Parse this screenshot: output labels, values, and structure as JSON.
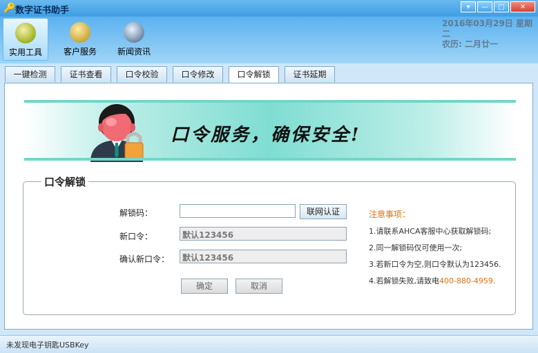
{
  "window": {
    "title": "数字证书助手"
  },
  "toolbar": {
    "items": [
      {
        "label": "实用工具",
        "icon": "tools-icon",
        "active": true
      },
      {
        "label": "客户服务",
        "icon": "customer-service-icon",
        "active": false
      },
      {
        "label": "新闻资讯",
        "icon": "news-icon",
        "active": false
      }
    ]
  },
  "date": {
    "gregorian": "2016年03月29日  星期二",
    "lunar": "农历:  二月廿一"
  },
  "tabs": [
    "一键检测",
    "证书查看",
    "口令校验",
    "口令修改",
    "口令解锁",
    "证书延期"
  ],
  "active_tab": 4,
  "banner": {
    "slogan": "口令服务，确保安全!"
  },
  "form": {
    "group_title": "口令解锁",
    "unlock_code_label": "解锁码：",
    "unlock_code_value": "",
    "verify_button": "联网认证",
    "new_pin_label": "新口令：",
    "new_pin_value": "默认123456",
    "confirm_pin_label": "确认新口令：",
    "confirm_pin_value": "默认123456",
    "ok_button": "确定",
    "cancel_button": "取消"
  },
  "notes": {
    "title": "注意事项：",
    "lines": [
      "1.请联系AHCA客服中心获取解锁码;",
      "2.同一解锁码仅可使用一次;",
      "3.若新口令为空,则口令默认为123456.",
      "4.若解锁失败,请致电"
    ],
    "phone": "400-880-4959."
  },
  "status": {
    "text": "未发现电子钥匙USBKey"
  },
  "colors": {
    "titlebar": "#3f9ee3",
    "accent": "#e07010",
    "banner": "#7fddd2"
  }
}
